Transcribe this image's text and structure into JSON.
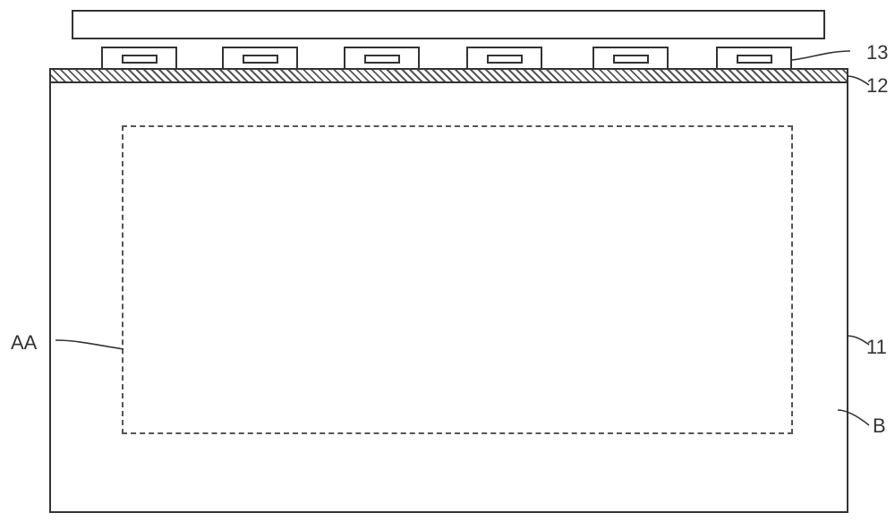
{
  "diagram": {
    "labels": {
      "label_13": "13",
      "label_12": "12",
      "label_11": "11",
      "label_AA": "AA",
      "label_B": "B"
    },
    "components": {
      "top_bar": "top-connector-bar",
      "hatched_strip": "hatched-bonding-strip",
      "chips_count": 6,
      "main_panel": "display-panel",
      "dashed_area": "active-area"
    }
  }
}
